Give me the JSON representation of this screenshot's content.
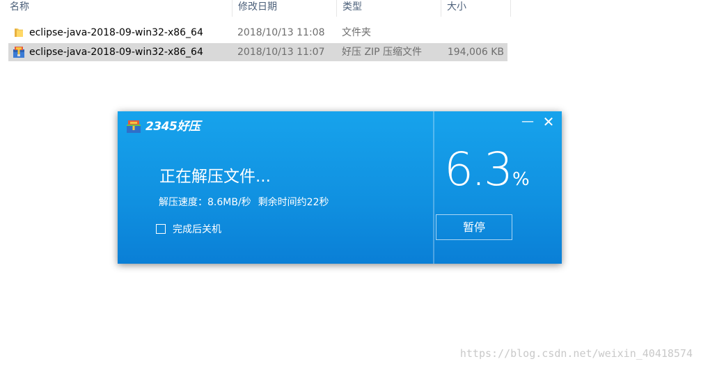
{
  "explorer": {
    "columns": {
      "name": "名称",
      "date": "修改日期",
      "type": "类型",
      "size": "大小"
    },
    "files": [
      {
        "name": "eclipse-java-2018-09-win32-x86_64",
        "date": "2018/10/13 11:08",
        "type": "文件夹",
        "size": "",
        "icon": "folder-icon",
        "selected": false
      },
      {
        "name": "eclipse-java-2018-09-win32-x86_64",
        "date": "2018/10/13 11:07",
        "type": "好压 ZIP 压缩文件",
        "size": "194,006 KB",
        "icon": "zip-archive-icon",
        "selected": true
      }
    ]
  },
  "dialog": {
    "logo": "2345好压",
    "status_title": "正在解压文件...",
    "speed": "解压速度：8.6MB/秒",
    "remaining": "剩余时间约22秒",
    "shutdown_label": "完成后关机",
    "shutdown_checked": false,
    "progress_value": "6.3",
    "progress_unit": "%",
    "pause_label": "暂停",
    "minimize_symbol": "—",
    "close_symbol": "✕",
    "colors": {
      "background_top": "#17a3ec",
      "background_bottom": "#0a7fd6",
      "text": "#ffffff"
    }
  },
  "watermark": "https://blog.csdn.net/weixin_40418574"
}
